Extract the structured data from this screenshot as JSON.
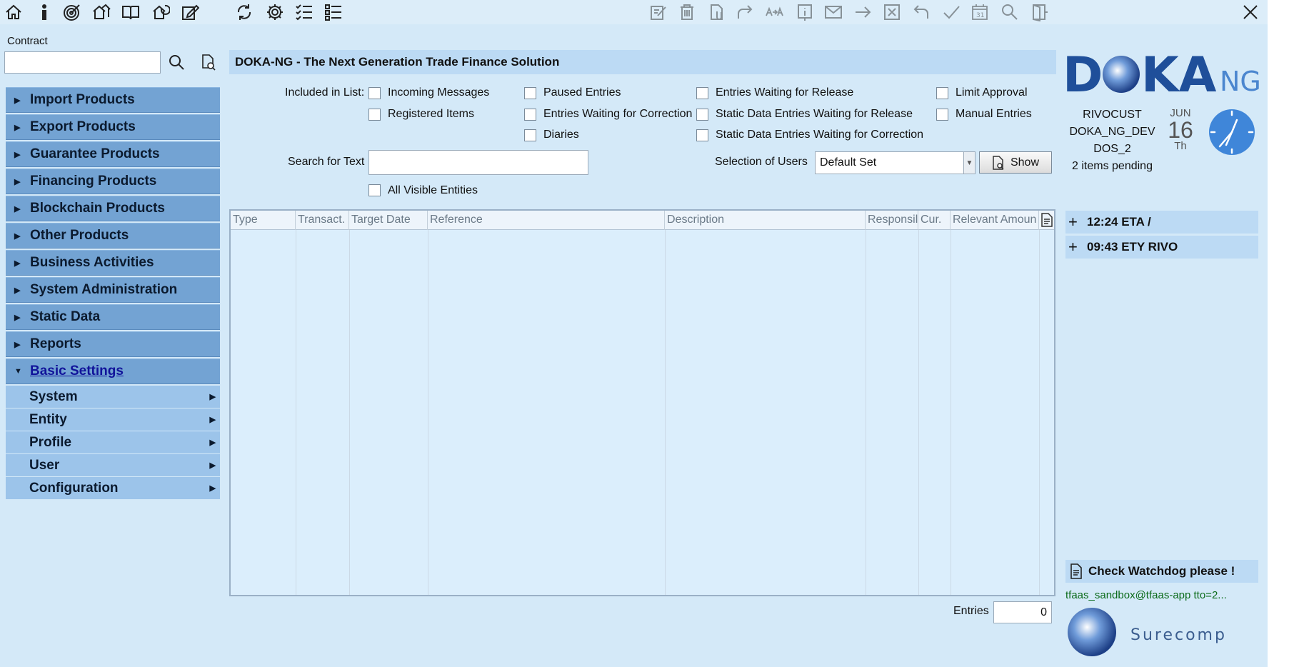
{
  "toolbar": {
    "left_icons": [
      "home-icon",
      "info-icon",
      "target-icon",
      "houses-icon",
      "book-icon",
      "home-refresh-icon",
      "edit-icon",
      "refresh-icon",
      "settings-icon",
      "checklist-icon",
      "list-icon"
    ],
    "right_icons": [
      "edit-doc-icon",
      "trash-icon",
      "attach-icon",
      "forward-icon",
      "transfer-icon",
      "info-box-icon",
      "mail-icon",
      "arrow-right-icon",
      "cancel-box-icon",
      "undo-icon",
      "check-icon",
      "calendar-icon",
      "search-icon",
      "door-icon"
    ]
  },
  "contract": {
    "label": "Contract",
    "value": ""
  },
  "menu": {
    "items": [
      {
        "label": "Import Products"
      },
      {
        "label": "Export Products"
      },
      {
        "label": "Guarantee Products"
      },
      {
        "label": "Financing Products"
      },
      {
        "label": "Blockchain Products"
      },
      {
        "label": "Other Products"
      },
      {
        "label": "Business Activities"
      },
      {
        "label": "System Administration"
      },
      {
        "label": "Static Data"
      },
      {
        "label": "Reports"
      },
      {
        "label": "Basic Settings"
      }
    ],
    "subitems": [
      {
        "label": "System"
      },
      {
        "label": "Entity"
      },
      {
        "label": "Profile"
      },
      {
        "label": "User"
      },
      {
        "label": "Configuration"
      }
    ]
  },
  "main": {
    "title": "DOKA-NG - The Next Generation Trade Finance Solution",
    "included_label": "Included in List:",
    "filters": [
      {
        "label": "Incoming Messages",
        "checked": false
      },
      {
        "label": "Registered Items",
        "checked": false
      },
      {
        "label": "Paused Entries",
        "checked": false
      },
      {
        "label": "Entries Waiting for Correction",
        "checked": false
      },
      {
        "label": "Diaries",
        "checked": false
      },
      {
        "label": "Entries Waiting for Release",
        "checked": false
      },
      {
        "label": "Static Data Entries Waiting for Release",
        "checked": false
      },
      {
        "label": "Static Data Entries Waiting for Correction",
        "checked": false
      },
      {
        "label": "Limit Approval",
        "checked": false
      },
      {
        "label": "Manual Entries",
        "checked": false
      }
    ],
    "search_label": "Search for Text",
    "search_value": "",
    "users_label": "Selection of Users",
    "users_value": "Default Set",
    "show_label": "Show",
    "all_visible_label": "All Visible Entities",
    "table": {
      "columns": [
        "Type",
        "Transact.",
        "Target Date",
        "Reference",
        "Description",
        "Responsil",
        "Cur.",
        "Relevant Amoun"
      ],
      "rows": []
    },
    "entries_label": "Entries",
    "entries_count": "0"
  },
  "side": {
    "brand": "DOKA",
    "brand_suffix": "NG",
    "customer": "RIVOCUST",
    "environment": "DOKA_NG_DEV",
    "instance": "DOS_2",
    "pending": "2 items pending",
    "cal_month": "JUN",
    "cal_day": "16",
    "cal_weekday": "Th",
    "events": [
      {
        "label": "12:24 ETA /"
      },
      {
        "label": "09:43 ETY RIVO"
      }
    ],
    "watchdog": "Check Watchdog please !",
    "user_line": "tfaas_sandbox@tfaas-app tto=2...",
    "vendor": "Surecomp"
  },
  "colors": {
    "background": "#d4e9f8",
    "menu": "#73a3d3",
    "submenu": "#9cc4ea",
    "accent": "#1f4f9a",
    "status_green": "#0b6b1a"
  }
}
